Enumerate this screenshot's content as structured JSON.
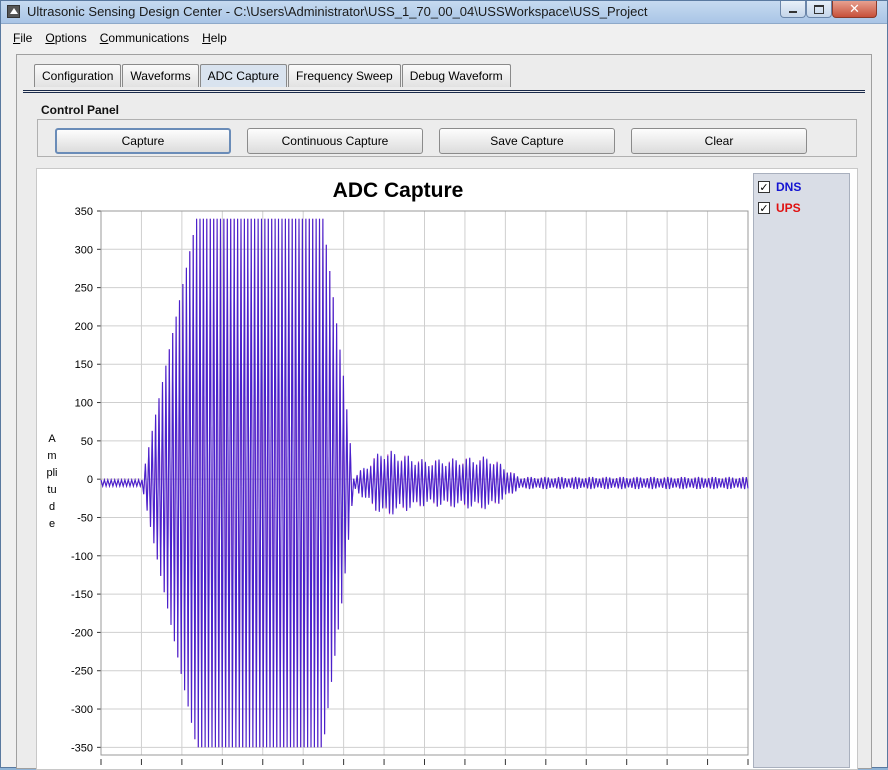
{
  "window": {
    "title": "Ultrasonic Sensing Design Center - C:\\Users\\Administrator\\USS_1_70_00_04\\USSWorkspace\\USS_Project"
  },
  "menu": [
    {
      "first": "F",
      "rest": "ile"
    },
    {
      "first": "O",
      "rest": "ptions"
    },
    {
      "first": "C",
      "rest": "ommunications"
    },
    {
      "first": "H",
      "rest": "elp"
    }
  ],
  "tabs": [
    "Configuration",
    "Waveforms",
    "ADC Capture",
    "Frequency Sweep",
    "Debug Waveform"
  ],
  "active_tab": "ADC Capture",
  "control_panel": {
    "title": "Control Panel",
    "buttons": [
      "Capture",
      "Continuous Capture",
      "Save Capture",
      "Clear"
    ]
  },
  "legend": [
    {
      "label": "DNS",
      "color": "#1414d2",
      "checked": true
    },
    {
      "label": "UPS",
      "color": "#e01010",
      "checked": true
    }
  ],
  "chart_data": {
    "type": "line",
    "title": "ADC Capture",
    "ylabel": "Amplitude",
    "yticks": [
      350,
      300,
      250,
      200,
      150,
      100,
      50,
      0,
      -50,
      -100,
      -150,
      -200,
      -250,
      -300,
      -350
    ],
    "ylim": [
      -360,
      350
    ],
    "x_count": 380,
    "grid": true,
    "legend_position": "right",
    "series": [
      {
        "name": "DNS",
        "color": "#2a1ad0"
      },
      {
        "name": "UPS",
        "color": "#b020b0"
      }
    ],
    "envelope_segments": [
      {
        "x_from": 0,
        "x_to": 24,
        "amp": 4
      },
      {
        "x_from": 24,
        "x_to": 56,
        "amp": 4,
        "amp_end": 345
      },
      {
        "x_from": 56,
        "x_to": 130,
        "amp": 345
      },
      {
        "x_from": 130,
        "x_to": 142,
        "amp": 345,
        "amp_end": 140
      },
      {
        "x_from": 142,
        "x_to": 148,
        "amp": 140,
        "amp_end": 8
      },
      {
        "x_from": 148,
        "x_to": 165,
        "amp": 8,
        "amp_end": 45
      },
      {
        "x_from": 165,
        "x_to": 190,
        "amp": 45,
        "amp_end": 30
      },
      {
        "x_from": 190,
        "x_to": 228,
        "amp": 30,
        "amp_end": 35
      },
      {
        "x_from": 228,
        "x_to": 245,
        "amp": 35,
        "amp_end": 8
      },
      {
        "x_from": 245,
        "x_to": 380,
        "amp": 8
      }
    ]
  }
}
